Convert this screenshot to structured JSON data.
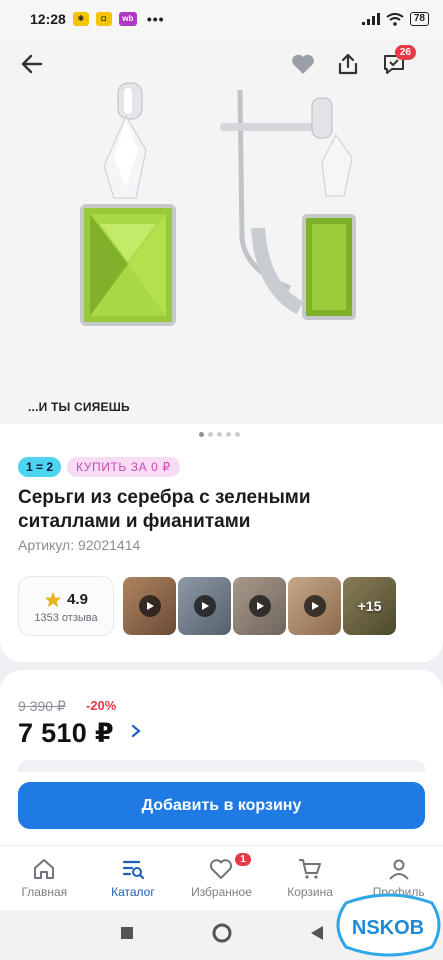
{
  "status": {
    "time": "12:28",
    "battery": "78",
    "apps": [
      "ya-icon",
      "market-icon",
      "wb-icon"
    ],
    "wb_label": "wb"
  },
  "gallery": {
    "slogan": "...И ТЫ СИЯЕШЬ",
    "pages": 5,
    "active_page": 0
  },
  "header": {
    "cart_count": "26"
  },
  "product": {
    "tag_promo": "1 = 2",
    "tag_buy": "КУПИТЬ ЗА 0 ₽",
    "title": "Серьги из серебра с зелеными ситаллами и фианитами",
    "article": "Артикул: 92021414",
    "rating": "4.9",
    "reviews": "1353 отзыва",
    "more_media": "+15"
  },
  "pricing": {
    "old_price": "9 390 ₽",
    "discount": "-20%",
    "price": "7 510 ₽",
    "add_to_cart": "Добавить в корзину"
  },
  "tabs": [
    {
      "label": "Главная",
      "icon": "home-icon"
    },
    {
      "label": "Каталог",
      "icon": "catalog-icon"
    },
    {
      "label": "Избранное",
      "icon": "heart-icon",
      "badge": "1"
    },
    {
      "label": "Корзина",
      "icon": "cart-icon"
    },
    {
      "label": "Профиль",
      "icon": "profile-icon"
    }
  ],
  "watermark": "NSKOB",
  "colors": {
    "accent": "#1f7be3",
    "active_tab": "#1b5fb9",
    "badge": "#e63a46",
    "promo_tag": "#4dd4f0",
    "buy_tag_bg": "#f7dcf3",
    "buy_tag_text": "#c54bb3"
  }
}
